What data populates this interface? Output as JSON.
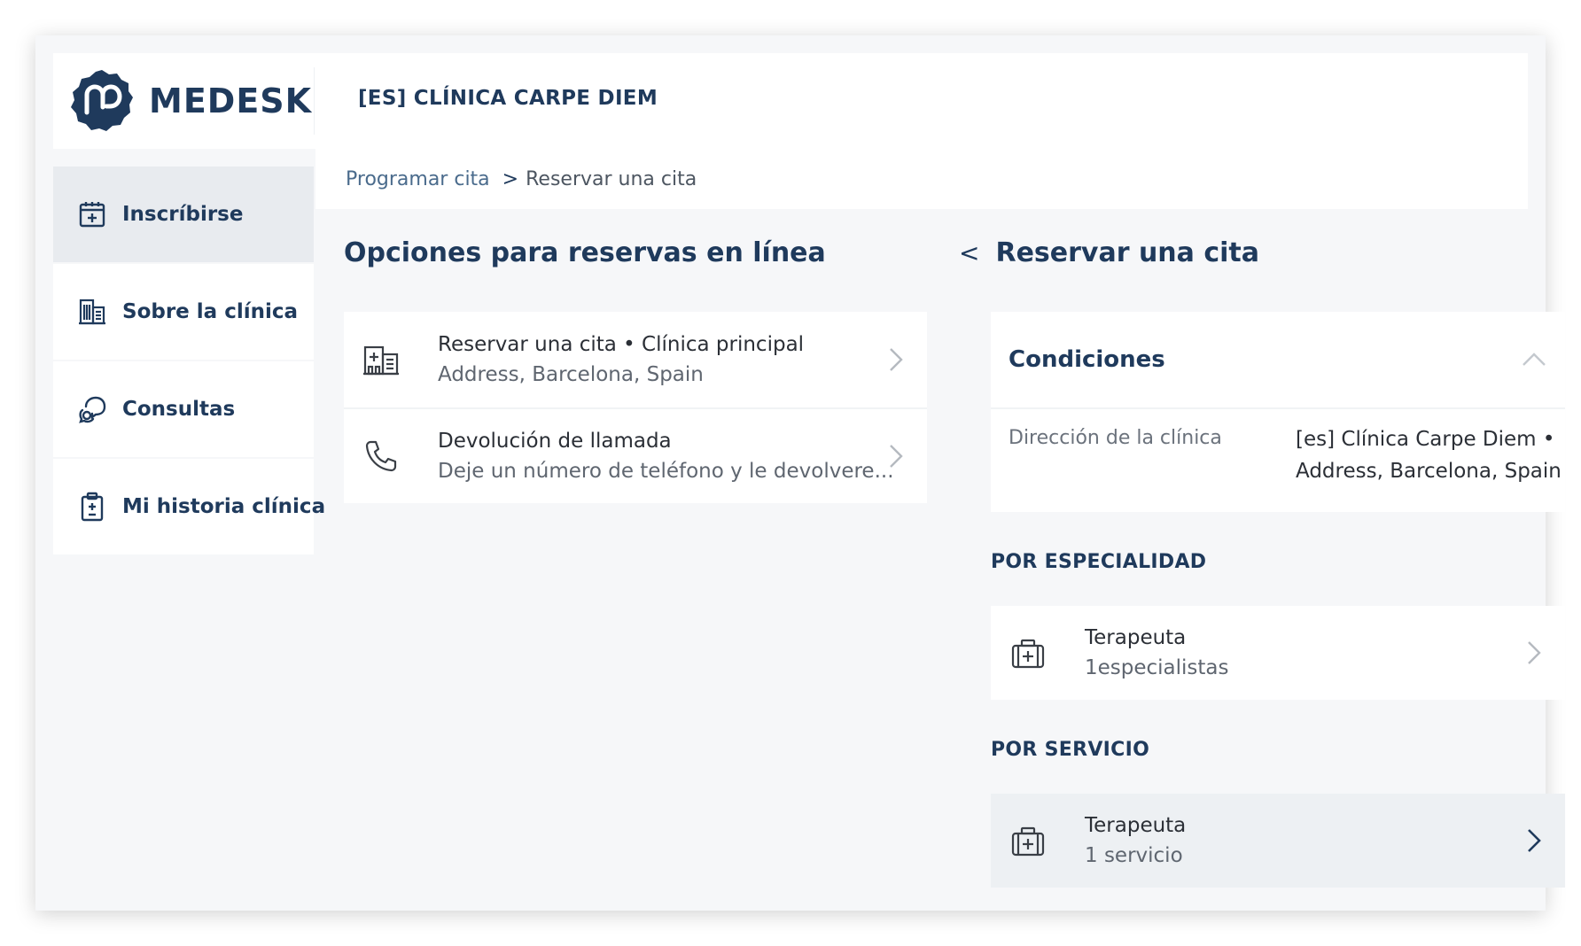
{
  "brand": {
    "logo_text": "MEDESK"
  },
  "header": {
    "clinic_name": "[ES] CLÍNICA CARPE DIEM"
  },
  "sidebar": {
    "items": [
      {
        "label": "Inscríbirse",
        "icon": "calendar-plus-icon",
        "active": true
      },
      {
        "label": "Sobre la clínica",
        "icon": "building-icon",
        "active": false
      },
      {
        "label": "Consultas",
        "icon": "chat-bubbles-icon",
        "active": false
      },
      {
        "label": "Mi historia clínica",
        "icon": "medical-record-icon",
        "active": false
      }
    ]
  },
  "breadcrumb": {
    "parent": "Programar cita",
    "separator": ">",
    "current": "Reservar una cita"
  },
  "left_panel": {
    "heading": "Opciones para reservas en línea",
    "options": [
      {
        "title": "Reservar una cita • Clínica principal",
        "subtitle": "Address, Barcelona, Spain",
        "icon": "clinic-building-icon"
      },
      {
        "title": "Devolución de llamada",
        "subtitle": "Deje un número de teléfono y le devolvere...",
        "icon": "phone-icon"
      }
    ]
  },
  "right_panel": {
    "back_glyph": "<",
    "heading": "Reservar una cita",
    "conditions": {
      "title": "Condiciones",
      "address_label": "Dirección de la clínica",
      "address_value": "[es] Clínica Carpe Diem • Address, Barcelona, Spain"
    },
    "by_specialty": {
      "label": "POR ESPECIALIDAD",
      "items": [
        {
          "title": "Terapeuta",
          "subtitle": "1especialistas",
          "icon": "medical-case-icon"
        }
      ]
    },
    "by_service": {
      "label": "POR SERVICIO",
      "items": [
        {
          "title": "Terapeuta",
          "subtitle": "1 servicio",
          "icon": "medical-case-icon"
        }
      ]
    }
  },
  "colors": {
    "brand_navy": "#1f3a5c",
    "background": "#f6f7f9",
    "active_sidebar": "#e8ebef",
    "hover_row": "#edf0f3"
  }
}
